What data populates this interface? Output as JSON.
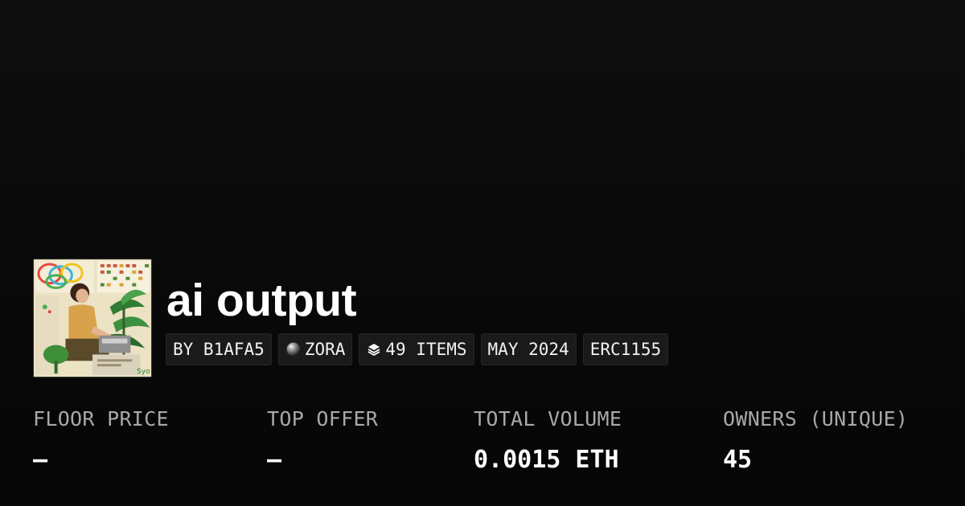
{
  "collection": {
    "title": "ai output",
    "thumbnail_icon": "collection-artwork-image"
  },
  "tags": {
    "creator": "BY B1AFA5",
    "network": "ZORA",
    "network_icon": "zora-orb-icon",
    "items": "49 ITEMS",
    "items_icon": "layers-icon",
    "date": "MAY 2024",
    "standard": "ERC1155"
  },
  "stats": {
    "floor_price": {
      "label": "FLOOR PRICE",
      "value": "—"
    },
    "top_offer": {
      "label": "TOP OFFER",
      "value": "—"
    },
    "total_volume": {
      "label": "TOTAL VOLUME",
      "value": "0.0015 ETH"
    },
    "owners": {
      "label": "OWNERS (UNIQUE)",
      "value": "45"
    }
  },
  "colors": {
    "background": "#0b0b0b",
    "tag_background": "#1a1a1a",
    "label_gray": "#a8a8a8",
    "text": "#ffffff"
  }
}
